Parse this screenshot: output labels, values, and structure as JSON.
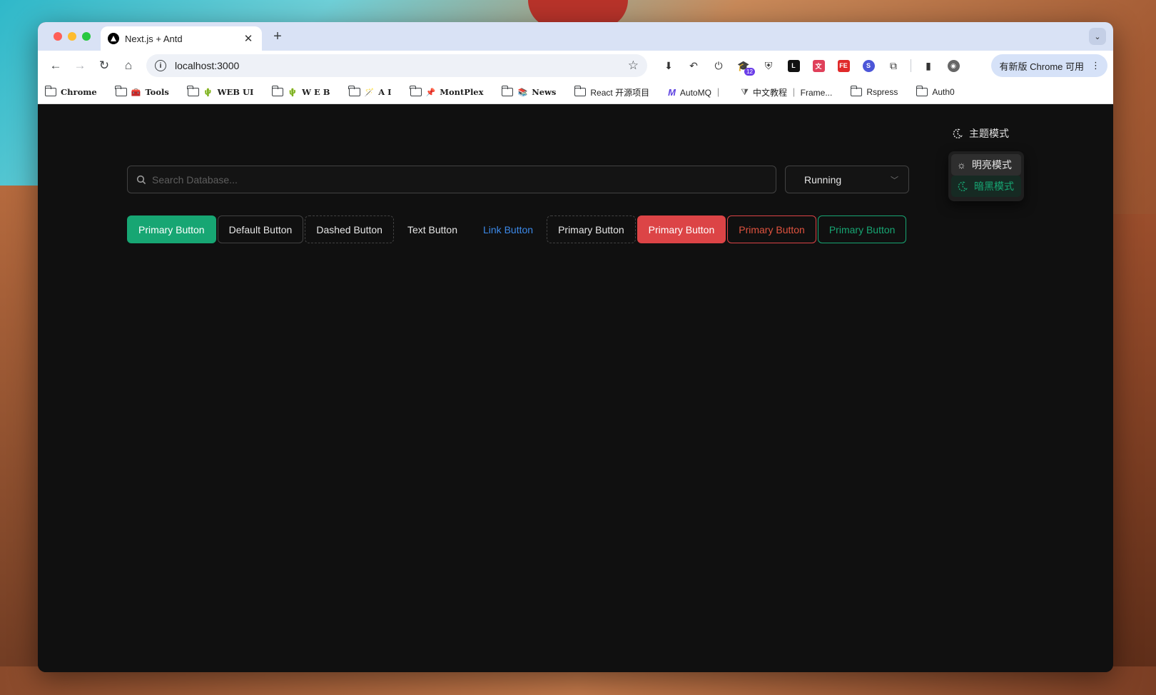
{
  "browser": {
    "tab_title": "Next.js + Antd",
    "url": "localhost:3000",
    "update_label": "有新版 Chrome 可用",
    "extension_badge": "12"
  },
  "bookmarks": [
    {
      "label": "Chrome",
      "emoji": ""
    },
    {
      "label": "Tools",
      "emoji": "🧰"
    },
    {
      "label": "WEB UI",
      "emoji": "🌵"
    },
    {
      "label": "W E B",
      "emoji": "🌵"
    },
    {
      "label": "A I",
      "emoji": "🪄"
    },
    {
      "label": "MontPlex",
      "emoji": "📌"
    },
    {
      "label": "News",
      "emoji": "📚"
    },
    {
      "label": "React 开源项目",
      "emoji": ""
    },
    {
      "label": "AutoMQ ｜",
      "emoji": ""
    },
    {
      "label": "中文教程 ｜ Frame...",
      "emoji": ""
    },
    {
      "label": "Rspress",
      "emoji": ""
    },
    {
      "label": "Auth0",
      "emoji": ""
    }
  ],
  "page": {
    "theme_trigger_label": "主题模式",
    "theme_menu": {
      "light_label": "明亮模式",
      "dark_label": "暗黑模式"
    },
    "search_placeholder": "Search Database...",
    "status_select_value": "Running",
    "buttons": {
      "primary": "Primary Button",
      "default": "Default Button",
      "dashed": "Dashed Button",
      "text": "Text Button",
      "link": "Link Button",
      "primary_dashed": "Primary Button",
      "danger_primary": "Primary Button",
      "danger_default": "Primary Button",
      "ghost_primary": "Primary Button"
    }
  },
  "colors": {
    "accent": "#17a673",
    "danger": "#dc4446",
    "link": "#3c89e8",
    "background": "#101010"
  }
}
